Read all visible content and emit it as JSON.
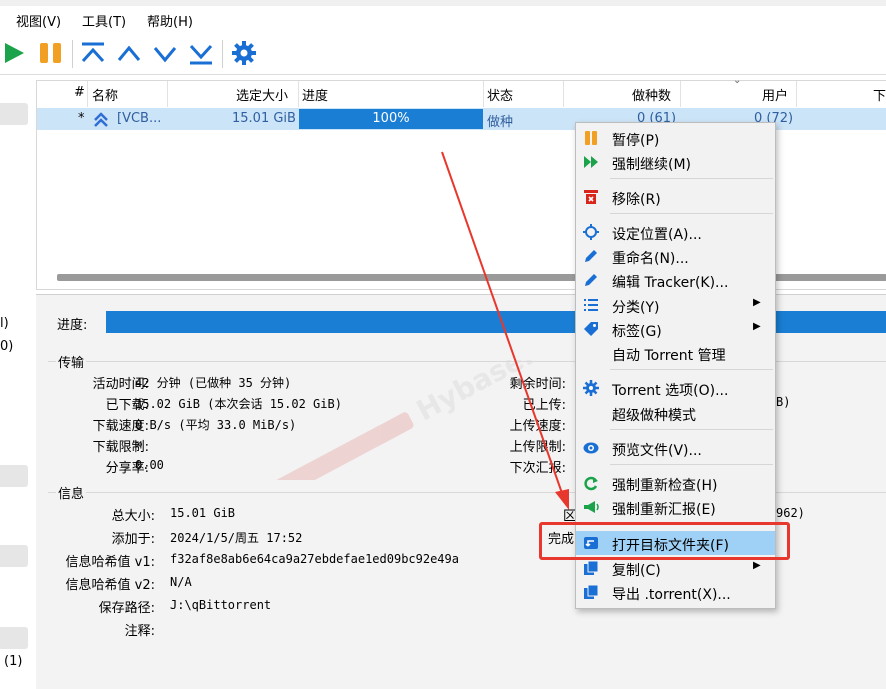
{
  "menubar": {
    "view": "视图(V)",
    "tools": "工具(T)",
    "help": "帮助(H)"
  },
  "colors": {
    "accent": "#1a7fd4",
    "play": "#1aa34a",
    "pause": "#f2a024",
    "nav": "#1a6fd4",
    "highlight": "#9fd0f5",
    "annotation": "#e8372c"
  },
  "left_strip": {
    "item1": "l)",
    "item2": "0)",
    "item3": "(1)"
  },
  "table": {
    "headers": {
      "num": "#",
      "name": "名称",
      "size": "选定大小",
      "progress": "进度",
      "status": "状态",
      "seeds": "做种数",
      "peers": "用户",
      "down": "下"
    },
    "row": {
      "num": "*",
      "name": "[VCB...",
      "size": "15.01 GiB",
      "progress": "100%",
      "status": "做种",
      "seeds": "0 (61)",
      "peers": "0 (72)"
    }
  },
  "props": {
    "progress_label": "进度:",
    "transfer_title": "传输",
    "active_time_label": "活动时间:",
    "active_time": "42 分钟 (已做种 35 分钟)",
    "downloaded_label": "已下载:",
    "downloaded": "15.02 GiB (本次会话 15.02 GiB)",
    "dl_speed_label": "下载速度:",
    "dl_speed": "0 B/s (平均 33.0 MiB/s)",
    "dl_limit_label": "下载限制:",
    "dl_limit": "∞",
    "ratio_label": "分享率:",
    "ratio": "0.00",
    "eta_label": "剩余时间:",
    "uploaded_label": "已上传:",
    "uploaded_tail": "B)",
    "ul_speed_label": "上传速度:",
    "ul_limit_label": "上传限制:",
    "next_announce_label": "下次汇报:",
    "info_title": "信息",
    "total_size_label": "总大小:",
    "total_size": "15.01 GiB",
    "added_on_label": "添加于:",
    "added_on": "2024/1/5/周五 17:52",
    "hash_v1_label": "信息哈希值 v1:",
    "hash_v1": "f32af8e8ab6e64ca9a27ebdefae1ed09bc92e49a",
    "hash_v2_label": "信息哈希值 v2:",
    "hash_v2": "N/A",
    "save_path_label": "保存路径:",
    "save_path": "J:\\qBittorrent",
    "comment_label": "注释:",
    "pieces_partial": "区",
    "pieces_tail": "962)",
    "completed_partial": "完成"
  },
  "context_menu": {
    "pause": "暂停(P)",
    "force_resume": "强制继续(M)",
    "remove": "移除(R)",
    "set_location": "设定位置(A)...",
    "rename": "重命名(N)...",
    "edit_tracker": "编辑 Tracker(K)...",
    "category": "分类(Y)",
    "tags": "标签(G)",
    "auto_tmm": "自动 Torrent 管理",
    "torrent_options": "Torrent 选项(O)...",
    "super_seeding": "超级做种模式",
    "preview_file": "预览文件(V)...",
    "force_recheck": "强制重新检查(H)",
    "force_reannounce": "强制重新汇报(E)",
    "open_folder": "打开目标文件夹(F)",
    "copy": "复制(C)",
    "export_torrent": "导出 .torrent(X)..."
  },
  "icons": [
    "play-icon",
    "pause-icon",
    "move-top-icon",
    "move-up-icon",
    "move-down-icon",
    "move-bottom-icon",
    "gear-icon"
  ]
}
